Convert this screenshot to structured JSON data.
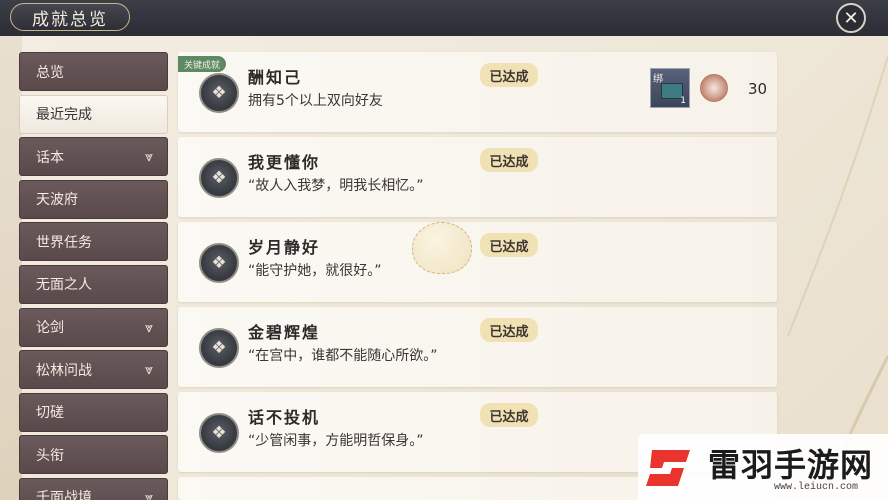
{
  "window": {
    "title": "成就总览",
    "close_label": "✕"
  },
  "sidebar": {
    "items": [
      {
        "label": "总览",
        "has_chevron": false,
        "active": false
      },
      {
        "label": "最近完成",
        "has_chevron": false,
        "active": true
      },
      {
        "label": "话本",
        "has_chevron": true,
        "active": false
      },
      {
        "label": "天波府",
        "has_chevron": false,
        "active": false
      },
      {
        "label": "世界任务",
        "has_chevron": false,
        "active": false
      },
      {
        "label": "无面之人",
        "has_chevron": false,
        "active": false
      },
      {
        "label": "论剑",
        "has_chevron": true,
        "active": false
      },
      {
        "label": "松林问战",
        "has_chevron": true,
        "active": false
      },
      {
        "label": "切磋",
        "has_chevron": false,
        "active": false
      },
      {
        "label": "头衔",
        "has_chevron": false,
        "active": false
      },
      {
        "label": "千面战境",
        "has_chevron": true,
        "active": false
      }
    ],
    "chevron_glyph": "⩔"
  },
  "achievements": [
    {
      "name": "酬知己",
      "desc": "拥有5个以上双向好友",
      "status": "已达成",
      "tag": "关键成就",
      "reward": {
        "bind_label": "绑",
        "qty": "1",
        "coin_count": "30"
      }
    },
    {
      "name": "我更懂你",
      "desc": "“故人入我梦，明我长相忆。”",
      "status": "已达成"
    },
    {
      "name": "岁月静好",
      "desc": "“能守护她，就很好。”",
      "status": "已达成"
    },
    {
      "name": "金碧辉煌",
      "desc": "“在宫中，谁都不能随心所欲。”",
      "status": "已达成"
    },
    {
      "name": "话不投机",
      "desc": "“少管闲事，方能明哲保身。”",
      "status": "已达成"
    }
  ],
  "watermark": {
    "brand": "雷羽手游网",
    "url": "www.leiucn.com"
  },
  "colors": {
    "topbar": "#2b2c34",
    "sidebar": "#5a494b",
    "status_bg": "#f1e2b6",
    "tag_bg": "#5e8a63"
  }
}
